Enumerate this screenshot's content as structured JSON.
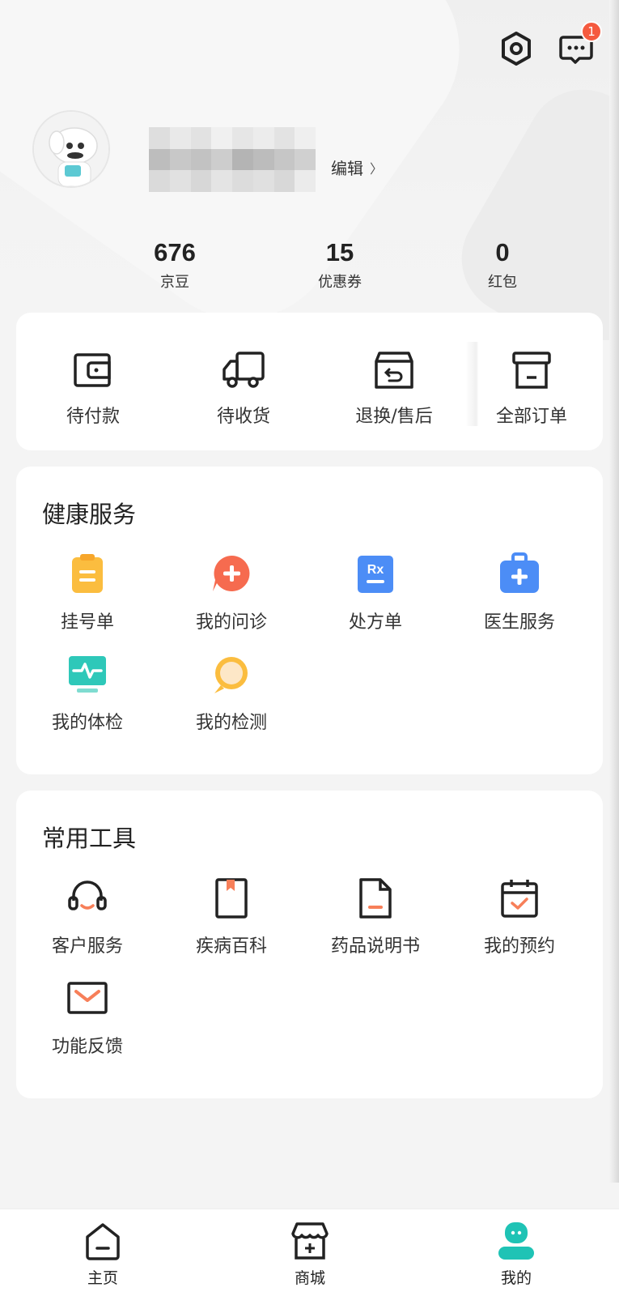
{
  "header": {
    "message_badge": "1",
    "edit_label": "编辑",
    "edit_chevron": "〉"
  },
  "stats": [
    {
      "value": "676",
      "label": "京豆"
    },
    {
      "value": "15",
      "label": "优惠券"
    },
    {
      "value": "0",
      "label": "红包"
    }
  ],
  "orders": [
    {
      "label": "待付款",
      "icon": "wallet-icon"
    },
    {
      "label": "待收货",
      "icon": "truck-icon"
    },
    {
      "label": "退换/售后",
      "icon": "return-box-icon"
    },
    {
      "label": "全部订单",
      "icon": "archive-box-icon"
    }
  ],
  "health": {
    "title": "健康服务",
    "items": [
      {
        "label": "挂号单",
        "icon": "clipboard-icon"
      },
      {
        "label": "我的问诊",
        "icon": "chat-plus-icon"
      },
      {
        "label": "处方单",
        "icon": "rx-icon"
      },
      {
        "label": "医生服务",
        "icon": "medkit-icon"
      },
      {
        "label": "我的体检",
        "icon": "monitor-pulse-icon"
      },
      {
        "label": "我的检测",
        "icon": "magnifier-icon"
      }
    ]
  },
  "tools": {
    "title": "常用工具",
    "items": [
      {
        "label": "客户服务",
        "icon": "headset-icon"
      },
      {
        "label": "疾病百科",
        "icon": "book-icon"
      },
      {
        "label": "药品说明书",
        "icon": "document-icon"
      },
      {
        "label": "我的预约",
        "icon": "calendar-check-icon"
      },
      {
        "label": "功能反馈",
        "icon": "envelope-icon"
      }
    ]
  },
  "tabbar": [
    {
      "label": "主页",
      "icon": "home-icon"
    },
    {
      "label": "商城",
      "icon": "store-icon"
    },
    {
      "label": "我的",
      "icon": "profile-icon",
      "active": true
    }
  ],
  "colors": {
    "accent_teal": "#1fc3b5",
    "badge_red": "#f55a3f",
    "orange": "#f77f59",
    "yellow": "#fbbd3f",
    "blue": "#4c8df6"
  }
}
